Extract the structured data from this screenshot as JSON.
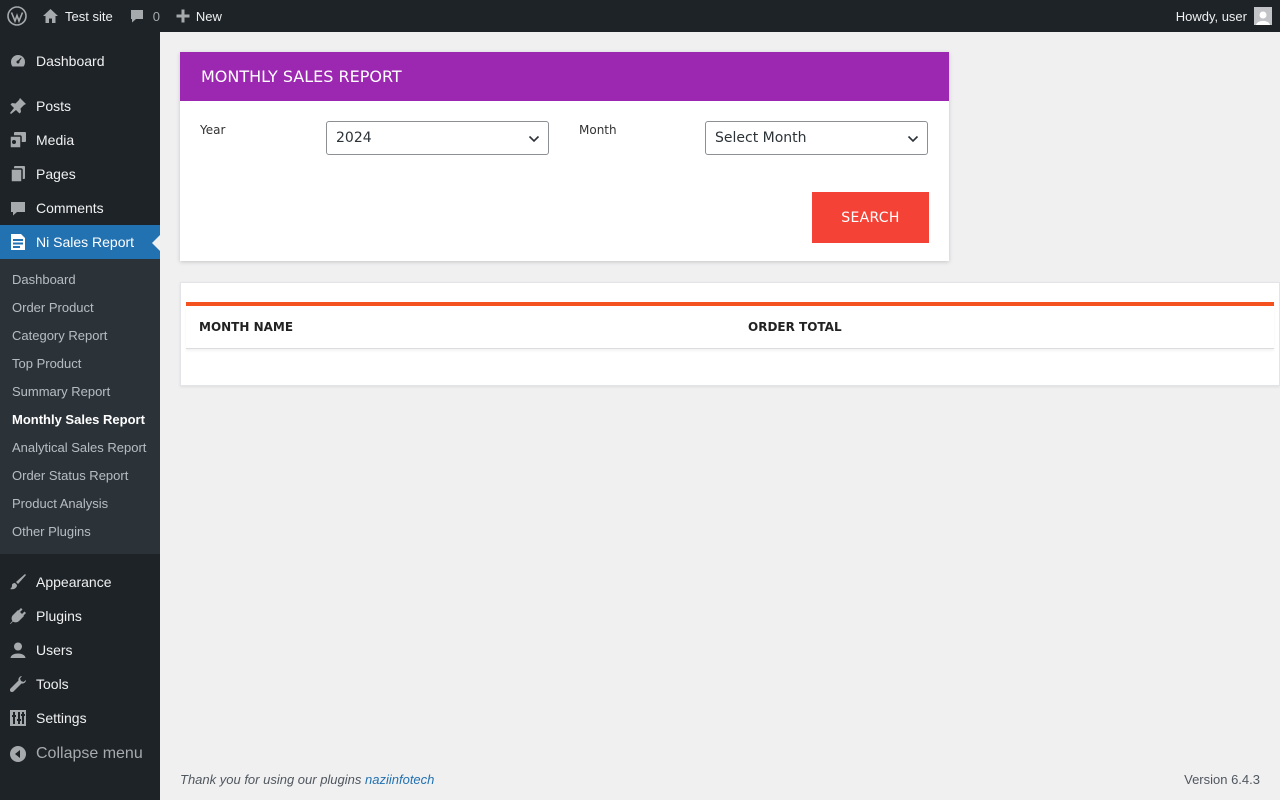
{
  "adminbar": {
    "wp_logo_icon": "wordpress-icon",
    "site_name": "Test site",
    "comments_count": "0",
    "new_label": "New",
    "greeting": "Howdy, user"
  },
  "sidebar": {
    "items_top": [
      {
        "label": "Dashboard",
        "icon": "dashboard-icon"
      }
    ],
    "items_main": [
      {
        "label": "Posts",
        "icon": "pin-icon"
      },
      {
        "label": "Media",
        "icon": "media-icon"
      },
      {
        "label": "Pages",
        "icon": "pages-icon"
      },
      {
        "label": "Comments",
        "icon": "comment-icon"
      }
    ],
    "current_item": {
      "label": "Ni Sales Report",
      "icon": "report-icon"
    },
    "submenu": [
      "Dashboard",
      "Order Product",
      "Category Report",
      "Top Product",
      "Summary Report",
      "Monthly Sales Report",
      "Analytical Sales Report",
      "Order Status Report",
      "Product Analysis",
      "Other Plugins"
    ],
    "submenu_current_index": 5,
    "items_bottom": [
      {
        "label": "Appearance",
        "icon": "brush-icon"
      },
      {
        "label": "Plugins",
        "icon": "plugin-icon"
      },
      {
        "label": "Users",
        "icon": "user-icon"
      },
      {
        "label": "Tools",
        "icon": "wrench-icon"
      },
      {
        "label": "Settings",
        "icon": "settings-icon"
      }
    ],
    "collapse_label": "Collapse menu"
  },
  "report": {
    "title": "MONTHLY SALES REPORT",
    "year_label": "Year",
    "year_value": "2024",
    "month_label": "Month",
    "month_value": "Select Month",
    "search_label": "SEARCH"
  },
  "table": {
    "columns": [
      "MONTH NAME",
      "ORDER TOTAL"
    ]
  },
  "footer": {
    "thanks_text": "Thank you for using our plugins",
    "link_text": "naziinfotech",
    "version": "Version 6.4.3"
  },
  "colors": {
    "admin_dark": "#1d2327",
    "wp_blue": "#2271b1",
    "header_purple": "#9c27b0",
    "search_red": "#f44336",
    "table_bar_orange": "#f4511e"
  }
}
